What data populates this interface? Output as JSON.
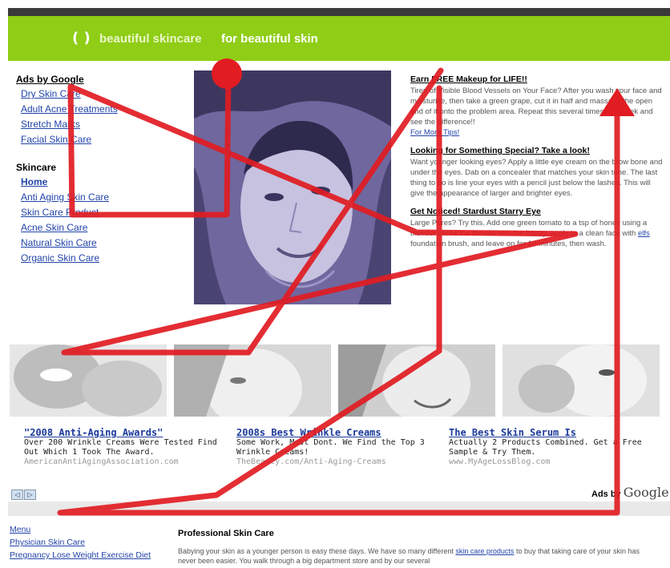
{
  "header": {
    "logo_glyph": "( )",
    "brand_name": "beautiful skincare",
    "tagline": "for beautiful skin"
  },
  "sidebar": {
    "ads_heading": "Ads by Google",
    "ads_links": [
      "Dry Skin Care",
      "Adult Acne Treatments",
      "Stretch Marks",
      "Facial Skin Care"
    ],
    "skincare_heading": "Skincare",
    "skincare_links": [
      "Home",
      "Anti Aging Skin Care",
      "Skin Care Product",
      "Acne Skin Care",
      "Natural Skin Care",
      "Organic Skin Care"
    ]
  },
  "articles": [
    {
      "title": "Earn FREE Makeup for LIFE!!",
      "body": "Tired of Visible Blood Vessels on Your Face? After you wash your face and moisturize, then take a green grape, cut it in half and massage the open end of it onto the problem area. Repeat this several times in a week and see the difference!!",
      "link": "For More Tips!"
    },
    {
      "title": "Looking for Something Special? Take a look!",
      "body": "Want younger looking eyes? Apply a little eye cream on the brow bone and under the eyes. Dab on a concealer that matches your skin tone. The last thing to do is line your eyes with a pencil just below the lashes. This will give the appearance of larger and brighter eyes.",
      "link": ""
    },
    {
      "title": "Get Noticed! Stardust Starry Eye",
      "body_before": "Large Pores? Try this. Add one green tomato to a tsp of honey using a blender puree the tomato with the honey, apply to a clean face with",
      "body_link": "elfs",
      "body_after": "foundation brush, and leave on for 10 minutes, then wash."
    }
  ],
  "ads": [
    {
      "title": "\"2008 Anti-Aging Awards\"",
      "body": "Over 200 Wrinkle Creams Were Tested Find Out Which 1 Took The Award.",
      "url": "AmericanAntiAgingAssociation.com"
    },
    {
      "title": "2008s Best Wrinkle Creams",
      "body": "Some Work, Most Dont. We Find the Top 3 Wrinkle Creams!",
      "url": "TheBeauty.com/Anti-Aging-Creams"
    },
    {
      "title": "The Best Skin Serum Is",
      "body": "Actually 2 Products Combined. Get a Free Sample & Try Them.",
      "url": "www.MyAgeLossBlog.com"
    }
  ],
  "ads_nav": {
    "prev": "◁",
    "next": "▷"
  },
  "adsby": {
    "prefix": "Ads by",
    "brand": "Google"
  },
  "footer": {
    "nav": [
      "Menu",
      "Physician Skin Care",
      "Pregnancy Lose Weight Exercise Diet"
    ],
    "title": "Professional Skin Care",
    "body_before": "Babying your skin as a younger person is easy these days. We have so many different",
    "body_link": "skin care products",
    "body_after": "to buy that taking care of your skin has never been easier. You walk through a big department store and by our several"
  },
  "colors": {
    "header_green": "#8fcd16",
    "overlay_red": "#e11c22",
    "link_blue": "#2244aa"
  }
}
